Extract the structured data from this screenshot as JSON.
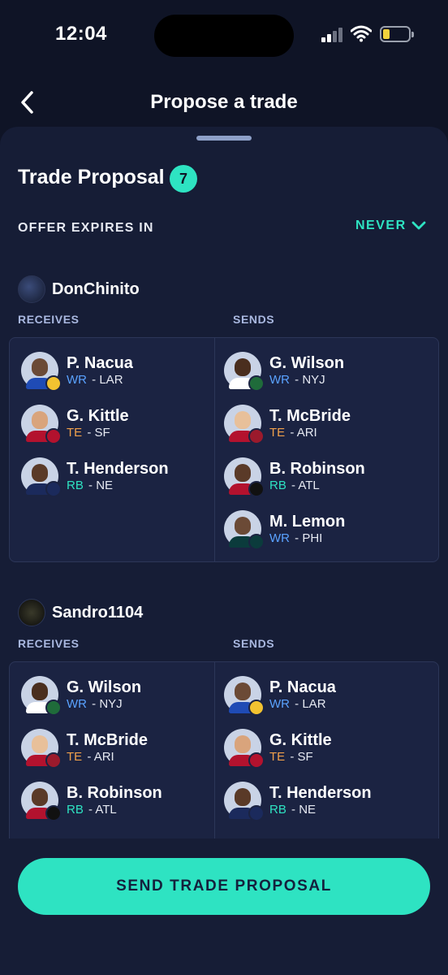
{
  "status": {
    "time": "12:04"
  },
  "header": {
    "title": "Propose a trade"
  },
  "proposal": {
    "title": "Trade Proposal",
    "count": "7"
  },
  "expires": {
    "label": "OFFER EXPIRES IN",
    "value": "NEVER"
  },
  "colors": {
    "accent": "#2ee3c2",
    "wr": "#5aa2ff",
    "te": "#f0a04b",
    "rb": "#2ee3c2",
    "background": "#0f1426",
    "sheet": "#161d36"
  },
  "trades": [
    {
      "user": "DonChinito",
      "receives_label": "RECEIVES",
      "sends_label": "SENDS",
      "receives": [
        {
          "name": "P. Nacua",
          "pos": "WR",
          "team": "LAR",
          "logo": "rams-logo-icon"
        },
        {
          "name": "G. Kittle",
          "pos": "TE",
          "team": "SF",
          "logo": "49ers-logo-icon"
        },
        {
          "name": "T. Henderson",
          "pos": "RB",
          "team": "NE",
          "logo": "patriots-logo-icon"
        }
      ],
      "sends": [
        {
          "name": "G. Wilson",
          "pos": "WR",
          "team": "NYJ",
          "logo": "jets-logo-icon"
        },
        {
          "name": "T. McBride",
          "pos": "TE",
          "team": "ARI",
          "logo": "cardinals-logo-icon"
        },
        {
          "name": "B. Robinson",
          "pos": "RB",
          "team": "ATL",
          "logo": "falcons-logo-icon"
        },
        {
          "name": "M. Lemon",
          "pos": "WR",
          "team": "PHI",
          "logo": "eagles-logo-icon"
        }
      ]
    },
    {
      "user": "Sandro1104",
      "receives_label": "RECEIVES",
      "sends_label": "SENDS",
      "receives": [
        {
          "name": "G. Wilson",
          "pos": "WR",
          "team": "NYJ",
          "logo": "jets-logo-icon"
        },
        {
          "name": "T. McBride",
          "pos": "TE",
          "team": "ARI",
          "logo": "cardinals-logo-icon"
        },
        {
          "name": "B. Robinson",
          "pos": "RB",
          "team": "ATL",
          "logo": "falcons-logo-icon"
        }
      ],
      "sends": [
        {
          "name": "P. Nacua",
          "pos": "WR",
          "team": "LAR",
          "logo": "rams-logo-icon"
        },
        {
          "name": "G. Kittle",
          "pos": "TE",
          "team": "SF",
          "logo": "49ers-logo-icon"
        },
        {
          "name": "T. Henderson",
          "pos": "RB",
          "team": "NE",
          "logo": "patriots-logo-icon"
        }
      ]
    }
  ],
  "cta": {
    "label": "SEND TRADE PROPOSAL"
  }
}
